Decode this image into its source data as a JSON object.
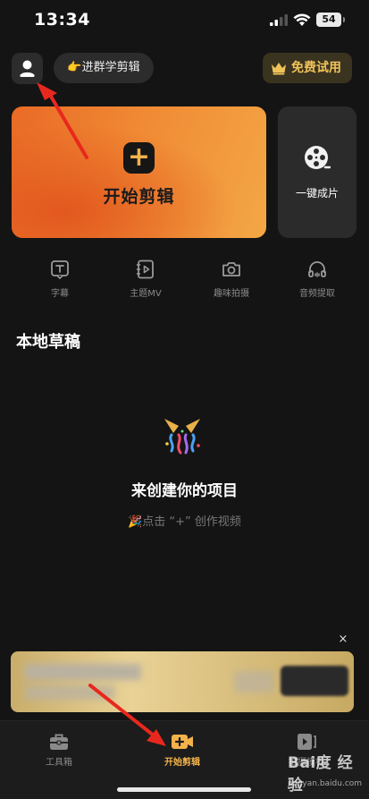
{
  "status_bar": {
    "time": "13:34",
    "battery": "54"
  },
  "top_bar": {
    "join_label": "👉进群学剪辑",
    "trial_label": "免费试用"
  },
  "cards": {
    "start_label": "开始剪辑",
    "oneclick_label": "一键成片"
  },
  "tools": [
    {
      "label": "字幕",
      "icon": "subtitle-icon"
    },
    {
      "label": "主题MV",
      "icon": "theme-mv-icon"
    },
    {
      "label": "趣味拍摄",
      "icon": "camera-icon"
    },
    {
      "label": "音频提取",
      "icon": "headphones-icon"
    }
  ],
  "drafts": {
    "title": "本地草稿",
    "empty_title": "来创建你的项目",
    "empty_subtitle": "🎉点击 “+” 创作视频"
  },
  "banner": {
    "close_glyph": "×"
  },
  "bottom_nav": [
    {
      "label": "工具箱",
      "icon": "toolbox-icon",
      "active": false
    },
    {
      "label": "开始剪辑",
      "icon": "video-add-icon",
      "active": true
    },
    {
      "label": "拍摄模板",
      "icon": "template-icon",
      "active": false
    }
  ],
  "watermark": {
    "brand": "Bai度 经验",
    "url": "jingyan.baidu.com"
  },
  "colors": {
    "accent": "#f3b24a",
    "background": "#141414",
    "annotation": "#e8281e"
  }
}
